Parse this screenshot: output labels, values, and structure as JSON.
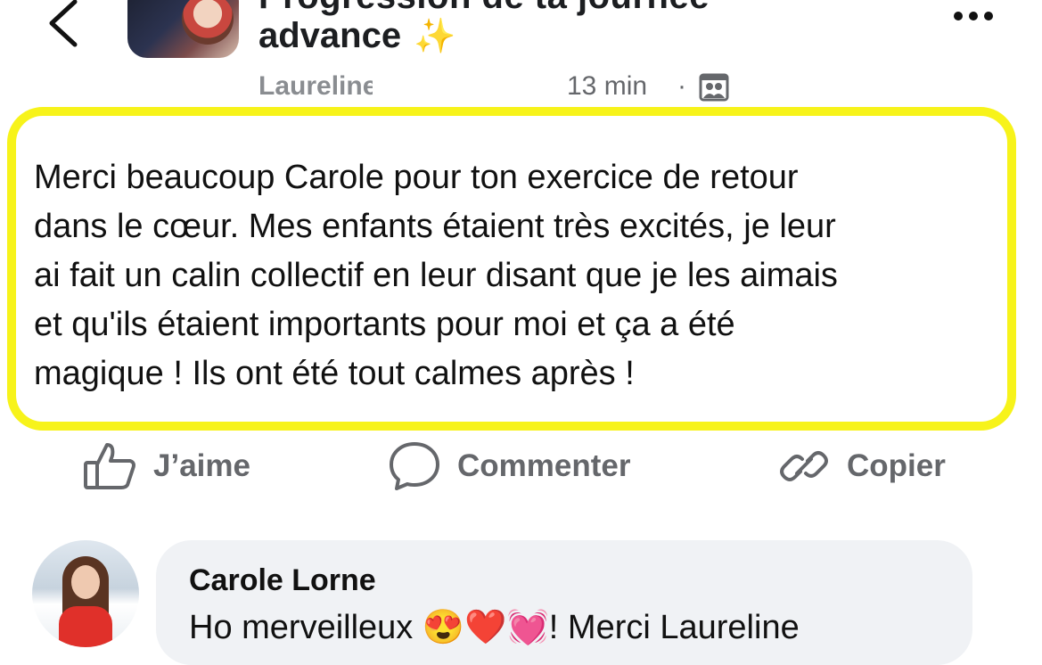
{
  "header": {
    "title_line_top": "Progression de ta journée",
    "title": "advance",
    "title_emoji": "✨",
    "icons": {
      "back": "chevron-left-icon",
      "more": "more-options-icon",
      "audience": "group-audience-icon"
    }
  },
  "post": {
    "author": "Laureline",
    "time": "13 min",
    "separator": "·",
    "text": "Merci beaucoup Carole pour ton exercice de retour\ndans le cœur. Mes enfants étaient très excités, je leur\nai fait un calin collectif en leur disant que je les aimais\net qu'ils étaient importants pour moi et ça a été\nmagique ! Ils ont été tout calmes après !",
    "highlight_color": "#f7f31a"
  },
  "actions": {
    "like": "J’aime",
    "comment": "Commenter",
    "copy": "Copier"
  },
  "comment": {
    "author": "Carole Lorne",
    "text": "Ho merveilleux 😍❤️💓! Merci Laureline"
  },
  "colors": {
    "text": "#111111",
    "muted": "#65676b",
    "bubble": "#f0f2f5"
  }
}
